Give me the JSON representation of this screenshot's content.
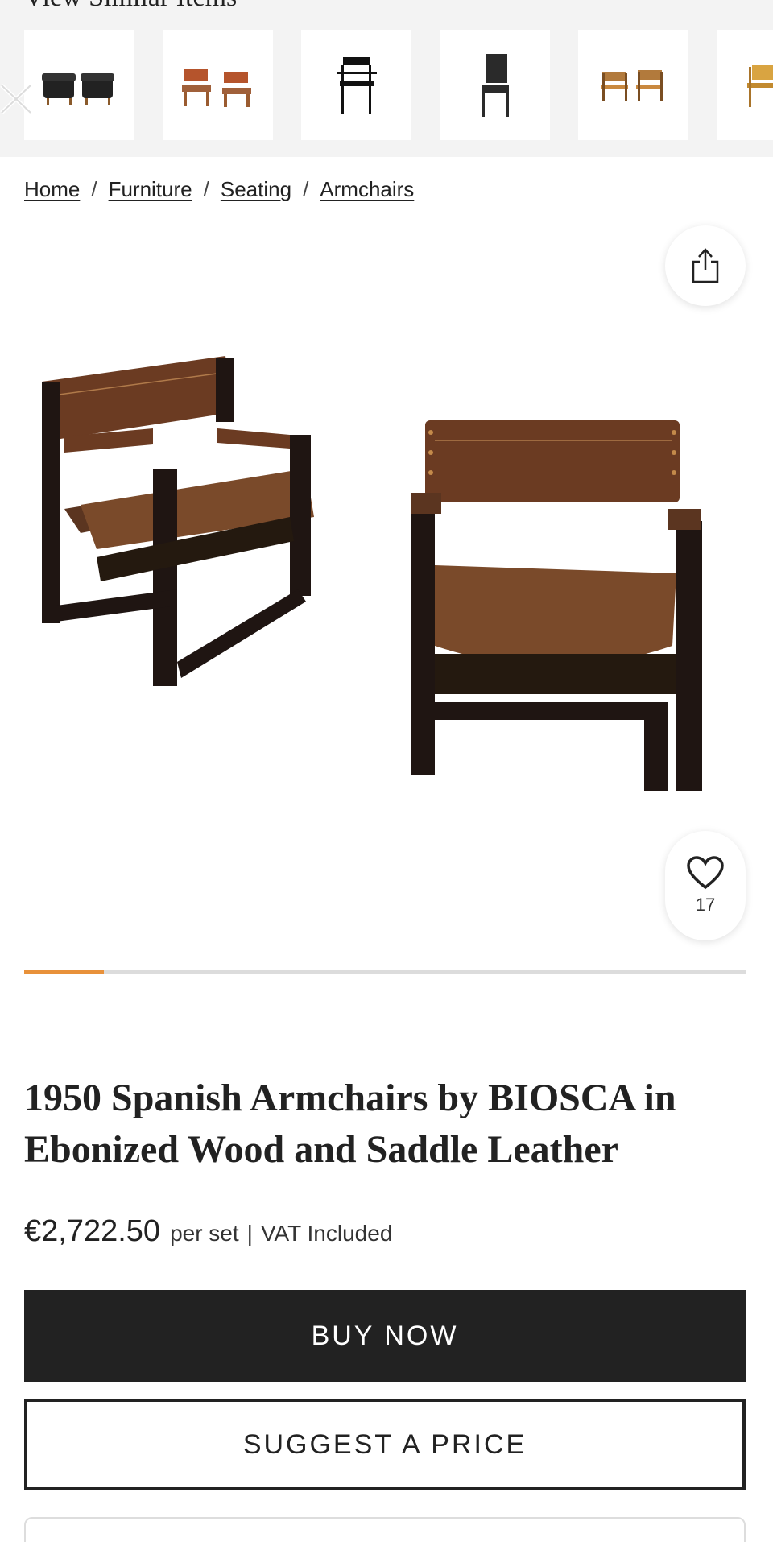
{
  "similar": {
    "heading": "View Similar Items",
    "thumbnails": [
      {
        "name": "leather-lounge-chairs-thumb"
      },
      {
        "name": "wood-armchairs-thumb"
      },
      {
        "name": "black-armchair-thumb"
      },
      {
        "name": "dark-side-chair-thumb"
      },
      {
        "name": "oak-armchairs-thumb"
      },
      {
        "name": "light-armchair-thumb"
      }
    ]
  },
  "breadcrumb": {
    "items": [
      "Home",
      "Furniture",
      "Seating",
      "Armchairs"
    ],
    "separator": "/"
  },
  "hero": {
    "favorite_count": "17",
    "progress": 0.11,
    "accent_color": "#e8913a"
  },
  "product": {
    "title": "1950 Spanish Armchairs by BIOSCA in Ebonized Wood and Saddle Leather",
    "price": "€2,722.50",
    "per_set": "per set",
    "divider": "|",
    "vat": "VAT Included"
  },
  "actions": {
    "buy_label": "BUY NOW",
    "suggest_label": "SUGGEST A PRICE"
  }
}
